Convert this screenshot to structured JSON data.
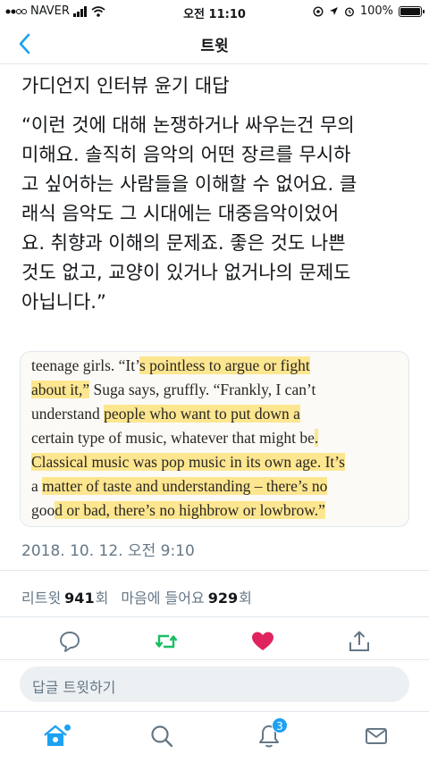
{
  "status_bar": {
    "carrier": "NAVER",
    "time": "오전 11:10",
    "battery": "100%",
    "battery_level": 1.0
  },
  "nav": {
    "title": "트윗"
  },
  "tweet": {
    "title": "가디언지 인터뷰 윤기 대답",
    "body": "“이런 것에 대해 논쟁하거나 싸우는건 무의\n미해요. 솔직히 음악의 어떤 장르를 무시하\n고 싶어하는 사람들을 이해할 수 없어요. 클\n래식 음악도 그 시대에는 대중음악이었어\n요. 취향과 이해의 문제죠. 좋은 것도 나쁜\n것도 없고, 교양이 있거나 없거나의 문제도\n아닙니다.”",
    "timestamp": "2018. 10. 12. 오전 9:10"
  },
  "image_text": {
    "lines": [
      [
        "teenage girls. “It’",
        "s pointless to argue or fight"
      ],
      [
        "",
        "about it,”",
        " Suga says, gruffly. “Frankly, I can’t"
      ],
      [
        "understand ",
        "people who want to put down a"
      ],
      [
        "certain type of music, whatever that might be",
        "."
      ],
      [
        "",
        "Classical music was pop music in its own age. It’s"
      ],
      [
        "a ",
        "matter of taste and understanding – there’s no"
      ],
      [
        "goo",
        "d or bad, there’s no highbrow or lowbrow.”"
      ]
    ]
  },
  "stats": {
    "retweet_label": "리트윗",
    "retweet_count": "941",
    "retweet_suffix": "회",
    "like_label": "마음에 들어요",
    "like_count": "929",
    "like_suffix": "회"
  },
  "reply": {
    "placeholder": "답글 트윗하기"
  },
  "tabs": {
    "notifications_badge": "3"
  },
  "colors": {
    "accent": "#1da1f2",
    "retweet": "#17bf63",
    "like": "#e0245e",
    "highlight": "#ffd63c"
  }
}
